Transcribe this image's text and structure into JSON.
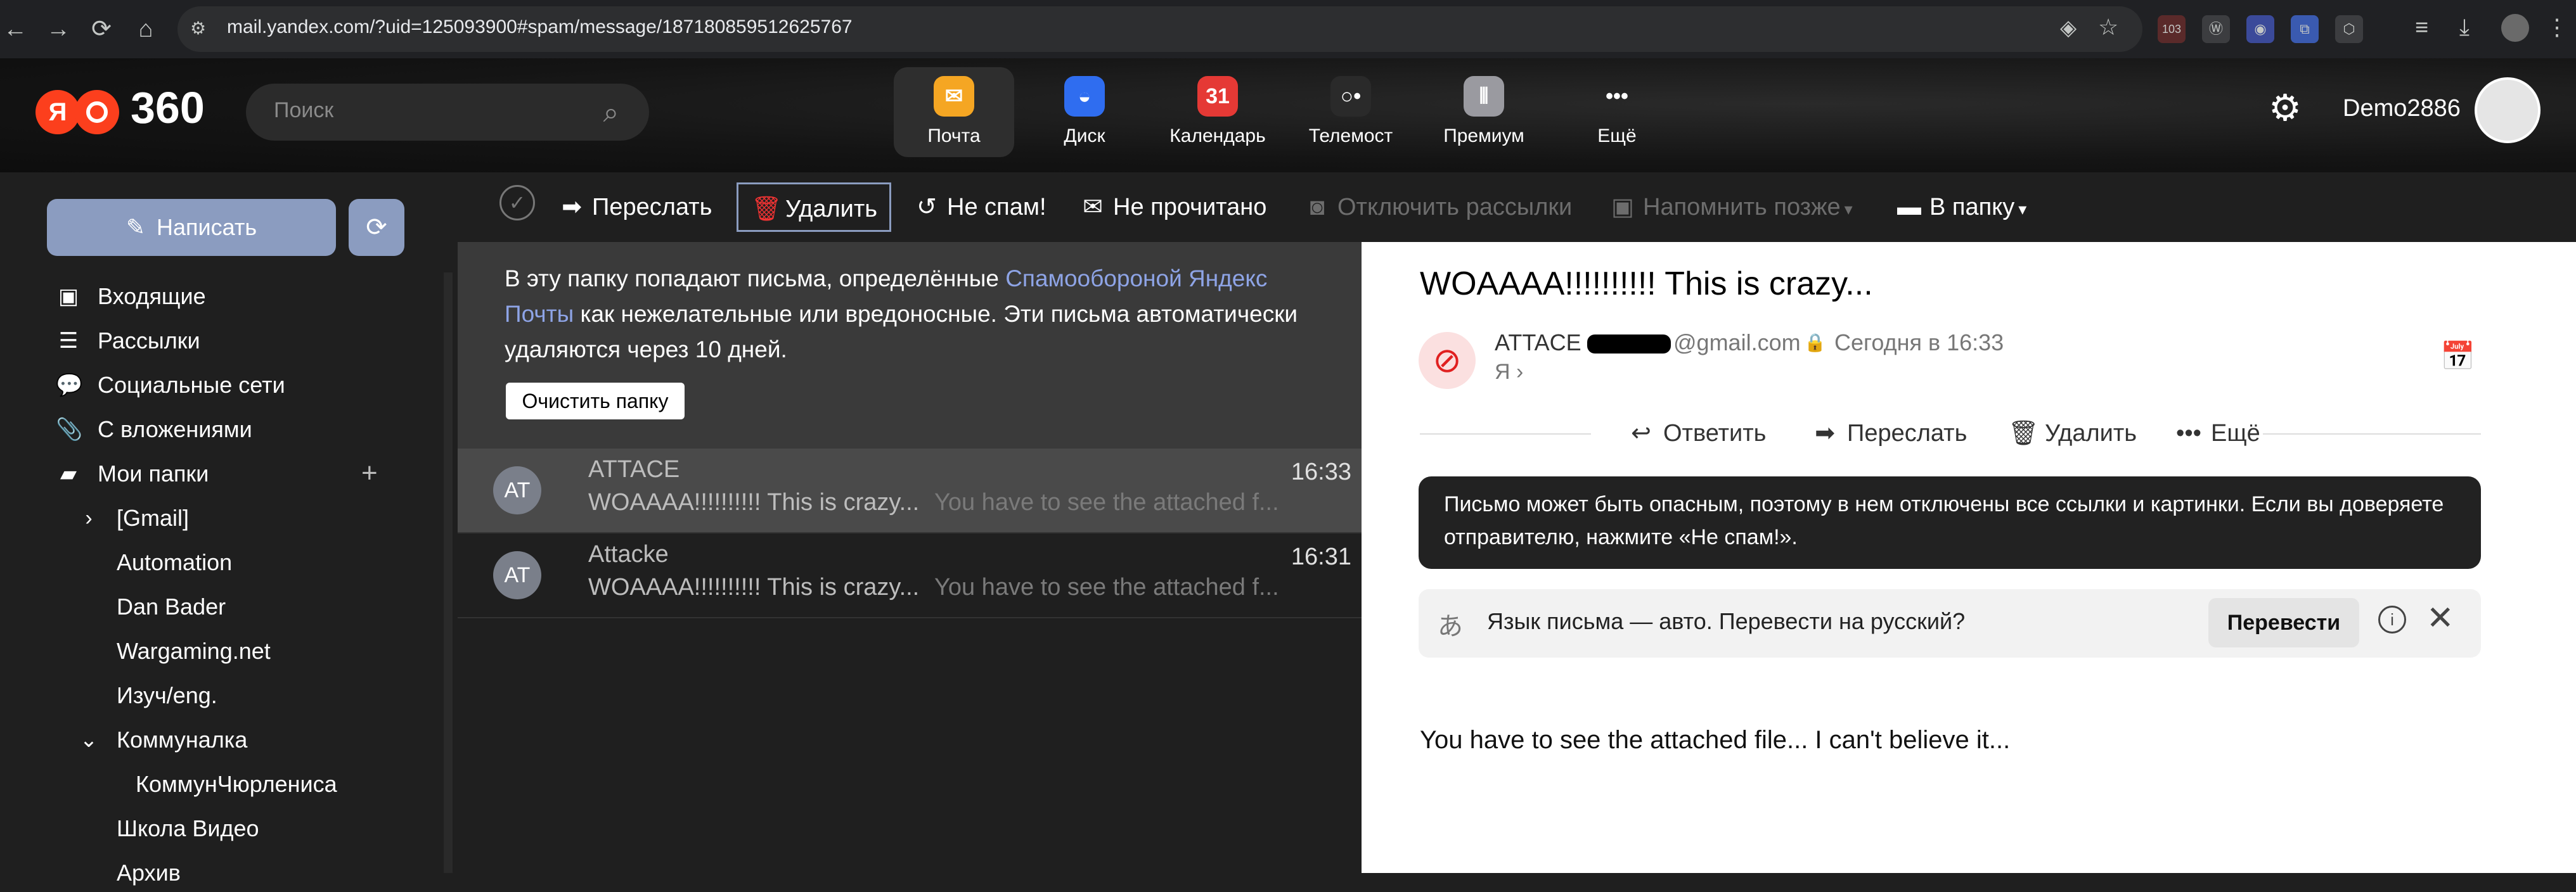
{
  "browser": {
    "url": "mail.yandex.com/?uid=125093900#spam/message/187180859512625767",
    "back_glyph": "←",
    "forward_glyph": "→",
    "reload_glyph": "⟳",
    "home_glyph": "⌂",
    "extension_badge": "103"
  },
  "header": {
    "logo_ya": "Я",
    "logo_text": "360",
    "search_placeholder": "Поиск",
    "services": [
      {
        "label": "Почта",
        "icon": "mail-icon",
        "color": "#f5a623",
        "glyph": "✉",
        "active": true
      },
      {
        "label": "Диск",
        "icon": "disk-icon",
        "color": "#2f6df0",
        "glyph": "◒",
        "active": false
      },
      {
        "label": "Календарь",
        "icon": "calendar-icon",
        "color": "#e53935",
        "glyph": "31",
        "active": false
      },
      {
        "label": "Телемост",
        "icon": "telemost-icon",
        "color": "#2a2a2a",
        "glyph": "○•",
        "active": false
      },
      {
        "label": "Премиум",
        "icon": "premium-icon",
        "color": "#9a9aa0",
        "glyph": "⦀",
        "active": false
      },
      {
        "label": "Ещё",
        "icon": "more-icon",
        "color": "transparent",
        "glyph": "•••",
        "active": false
      }
    ],
    "username": "Demo2886"
  },
  "sidebar": {
    "compose_label": "Написать",
    "items": [
      {
        "label": "Входящие",
        "icon": "inbox-icon",
        "glyph": "▣",
        "indent": 0
      },
      {
        "label": "Рассылки",
        "icon": "newsletters-icon",
        "glyph": "☰",
        "indent": 0
      },
      {
        "label": "Социальные сети",
        "icon": "social-icon",
        "glyph": "💬",
        "indent": 0
      },
      {
        "label": "С вложениями",
        "icon": "attachment-icon",
        "glyph": "📎",
        "indent": 0
      },
      {
        "label": "Мои папки",
        "icon": "folders-icon",
        "glyph": "▰",
        "indent": 0
      },
      {
        "label": "[Gmail]",
        "icon": "chevron-right-icon",
        "glyph": "›",
        "indent": 1
      },
      {
        "label": "Automation",
        "icon": "",
        "glyph": "",
        "indent": 1
      },
      {
        "label": "Dan Bader",
        "icon": "",
        "glyph": "",
        "indent": 1
      },
      {
        "label": "Wargaming.net",
        "icon": "",
        "glyph": "",
        "indent": 1
      },
      {
        "label": "Изуч/eng.",
        "icon": "",
        "glyph": "",
        "indent": 1
      },
      {
        "label": "Коммуналка",
        "icon": "chevron-down-icon",
        "glyph": "⌄",
        "indent": 1
      },
      {
        "label": "КоммунЧюрлениса",
        "icon": "",
        "glyph": "",
        "indent": 2
      },
      {
        "label": "Школа Видео",
        "icon": "",
        "glyph": "",
        "indent": 1
      },
      {
        "label": "Архив",
        "icon": "",
        "glyph": "",
        "indent": 1
      }
    ]
  },
  "toolbar": {
    "forward": "Переслать",
    "delete": "Удалить",
    "not_spam": "Не спам!",
    "unread": "Не прочитано",
    "unsubscribe": "Отключить рассылки",
    "remind": "Напомнить позже",
    "to_folder": "В папку"
  },
  "spam_info": {
    "text_before": "В эту папку попадают письма, определённые ",
    "link": "Спамообороной Яндекс Почты",
    "text_after": " как нежелательные или вредоносные. Эти письма автоматически удаляются через 10 дней.",
    "clear_button": "Очистить папку"
  },
  "messages": [
    {
      "avatar": "AT",
      "from": "ATTACE",
      "subject": "WOAAAA!!!!!!!!!! This is crazy...",
      "snippet": "You have to see the attached f...",
      "time": "16:33",
      "selected": true
    },
    {
      "avatar": "AT",
      "from": "Attacke",
      "subject": "WOAAAA!!!!!!!!!! This is crazy...",
      "snippet": "You have to see the attached f...",
      "time": "16:31",
      "selected": false
    }
  ],
  "message": {
    "subject": "WOAAAA!!!!!!!!!! This is crazy...",
    "sender_name": "ATTACE",
    "sender_domain": "@gmail.com",
    "date": "Сегодня в 16:33",
    "recipient": "Я ›",
    "actions": {
      "reply": "Ответить",
      "forward": "Переслать",
      "delete": "Удалить",
      "more": "Ещё"
    },
    "warning": "Письмо может быть опасным, поэтому в нем отключены все ссылки и картинки. Если вы доверяете отправителю, нажмите «Не спам!».",
    "translate_prompt": "Язык письма — авто. Перевести на русский?",
    "translate_button": "Перевести",
    "body": "You have to see the attached file... I can't believe it..."
  }
}
